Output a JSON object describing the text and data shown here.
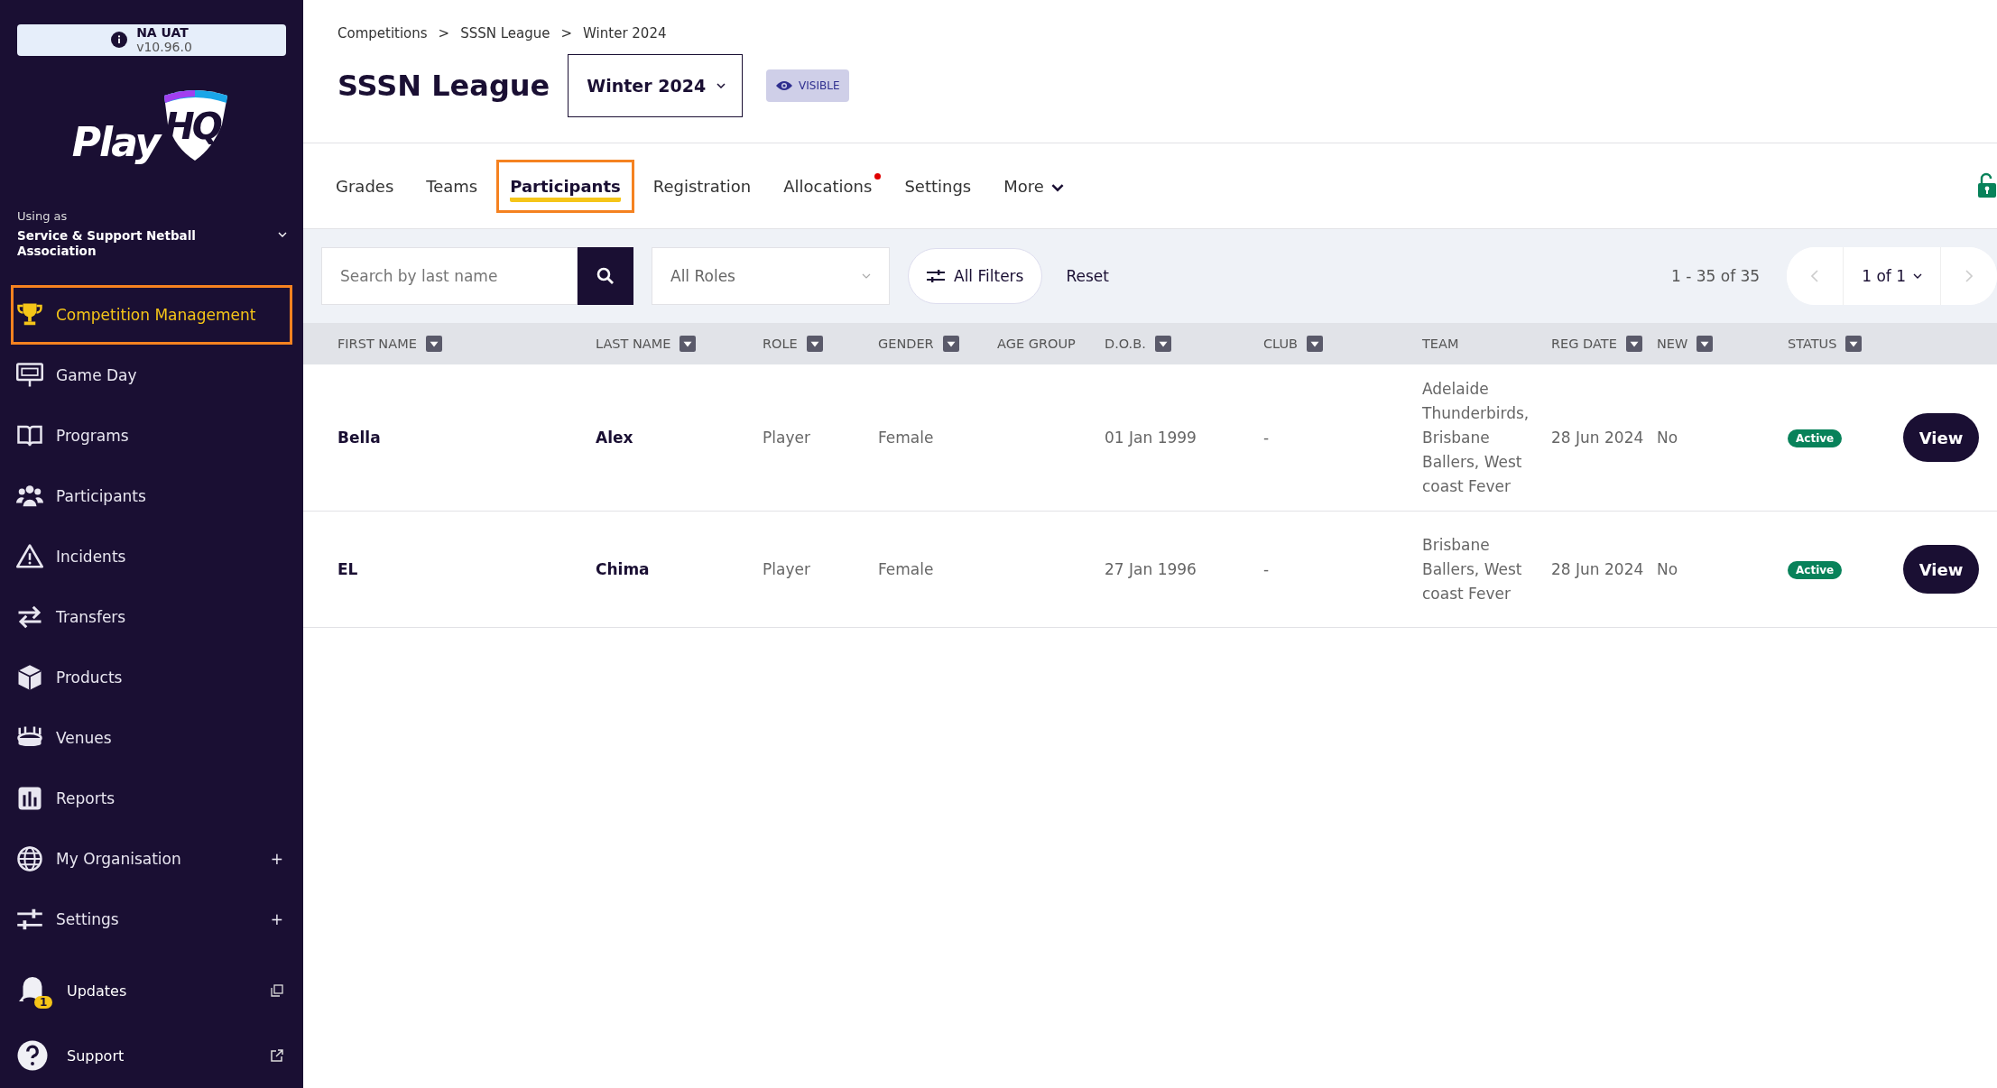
{
  "env_badge": {
    "name": "NA UAT",
    "version": "v10.96.0"
  },
  "logo": {
    "word": "Play",
    "mark": "HQ"
  },
  "org": {
    "caption": "Using as",
    "name": "Service & Support Netball Association"
  },
  "sidebar": {
    "items": [
      {
        "label": "Competition Management",
        "selected": true,
        "highlighted": true
      },
      {
        "label": "Game Day",
        "selected": false,
        "highlighted": false
      },
      {
        "label": "Programs",
        "selected": false,
        "highlighted": false
      },
      {
        "label": "Participants",
        "selected": false,
        "highlighted": false
      },
      {
        "label": "Incidents",
        "selected": false,
        "highlighted": false
      },
      {
        "label": "Transfers",
        "selected": false,
        "highlighted": false
      },
      {
        "label": "Products",
        "selected": false,
        "highlighted": false
      },
      {
        "label": "Venues",
        "selected": false,
        "highlighted": false
      },
      {
        "label": "Reports",
        "selected": false,
        "highlighted": false
      },
      {
        "label": "My Organisation",
        "selected": false,
        "highlighted": false,
        "expand": "+"
      },
      {
        "label": "Settings",
        "selected": false,
        "highlighted": false,
        "expand": "+"
      }
    ],
    "footer": [
      {
        "label": "Updates",
        "badge": "1"
      },
      {
        "label": "Support"
      }
    ]
  },
  "breadcrumbs": [
    "Competitions",
    "SSSN League",
    "Winter 2024"
  ],
  "breadcrumb_separator": ">",
  "page_title": "SSSN League",
  "season_select": {
    "value": "Winter 2024"
  },
  "visibility": {
    "label": "VISIBLE"
  },
  "tabs": [
    {
      "label": "Grades",
      "selected": false,
      "highlighted": false,
      "notification": false
    },
    {
      "label": "Teams",
      "selected": false,
      "highlighted": false,
      "notification": false
    },
    {
      "label": "Participants",
      "selected": true,
      "highlighted": true,
      "notification": false
    },
    {
      "label": "Registration",
      "selected": false,
      "highlighted": false,
      "notification": false
    },
    {
      "label": "Allocations",
      "selected": false,
      "highlighted": false,
      "notification": true
    },
    {
      "label": "Settings",
      "selected": false,
      "highlighted": false,
      "notification": false
    },
    {
      "label": "More",
      "selected": false,
      "highlighted": false,
      "notification": false,
      "dropdown": true
    }
  ],
  "filters": {
    "search_placeholder": "Search by last name",
    "role_select": "All Roles",
    "all_filters": "All Filters",
    "reset": "Reset"
  },
  "pagination": {
    "range": "1 - 35 of 35",
    "page": "1 of 1"
  },
  "table": {
    "columns": [
      {
        "label": "FIRST NAME",
        "filter": true
      },
      {
        "label": "LAST NAME",
        "filter": true
      },
      {
        "label": "ROLE",
        "filter": true
      },
      {
        "label": "GENDER",
        "filter": true
      },
      {
        "label": "AGE GROUP",
        "filter": false
      },
      {
        "label": "D.O.B.",
        "filter": true
      },
      {
        "label": "CLUB",
        "filter": true
      },
      {
        "label": "TEAM",
        "filter": false
      },
      {
        "label": "REG DATE",
        "filter": true
      },
      {
        "label": "NEW",
        "filter": true
      },
      {
        "label": "STATUS",
        "filter": true
      }
    ],
    "rows": [
      {
        "first_name": "Bella",
        "last_name": "Alex",
        "role": "Player",
        "gender": "Female",
        "dob": "01 Jan 1999",
        "club": "-",
        "team": "Adelaide Thunderbirds, Brisbane Ballers, West coast Fever",
        "reg_date": "28 Jun 2024",
        "new": "No",
        "status": "Active",
        "action": "View"
      },
      {
        "first_name": "EL",
        "last_name": "Chima",
        "role": "Player",
        "gender": "Female",
        "dob": "27 Jan 1996",
        "club": "-",
        "team": "Brisbane Ballers, West coast Fever",
        "reg_date": "28 Jun 2024",
        "new": "No",
        "status": "Active",
        "action": "View"
      }
    ]
  }
}
